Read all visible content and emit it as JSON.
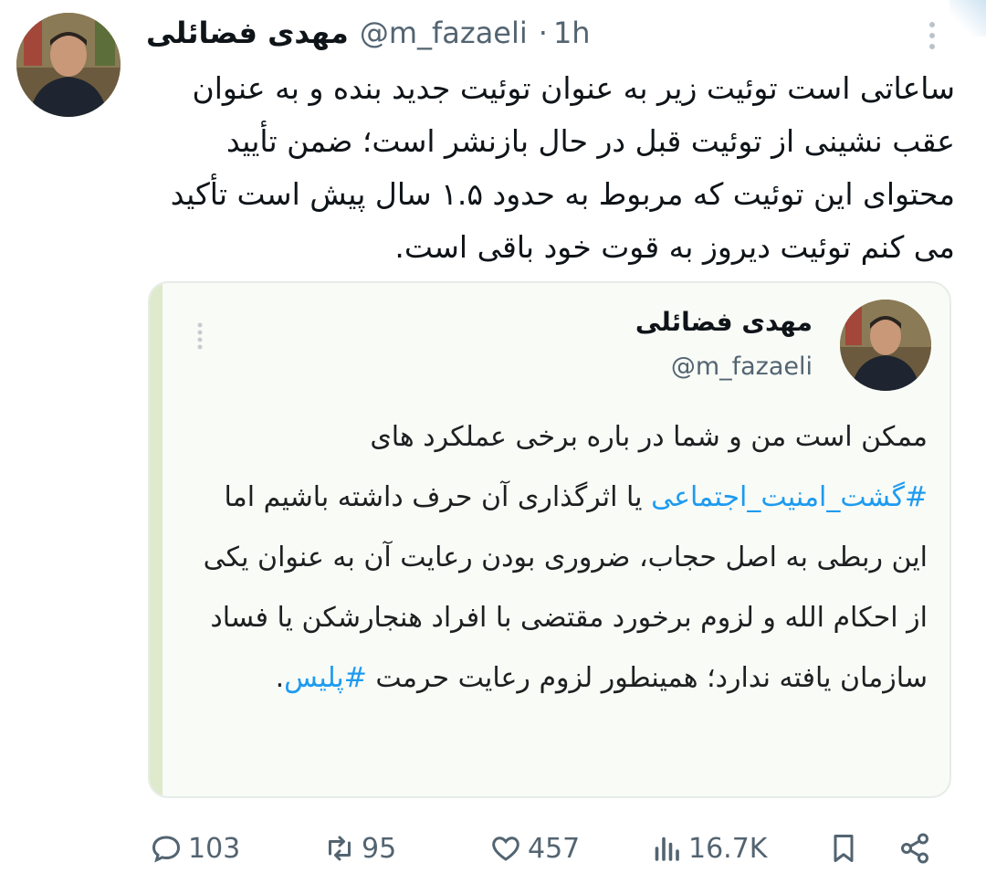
{
  "tweet": {
    "display_name": "مهدی فضائلی",
    "handle": "@m_fazaeli",
    "separator": "·",
    "time": "1h",
    "text": "ساعاتی است توئیت زیر به عنوان توئیت جدید بنده و به عنوان عقب نشینی از توئیت قبل در حال بازنشر است؛ ضمن تأیید محتوای این توئیت که مربوط به حدود ۱.۵ سال پیش است تأکید می کنم توئیت دیروز به قوت خود باقی است."
  },
  "quoted": {
    "display_name": "مهدی فضائلی",
    "handle": "@m_fazaeli",
    "text_part1": "ممکن است من و شما در باره برخی عملکرد های ",
    "hashtag1": "#گشت_امنیت_اجتماعی",
    "text_part2": " یا اثرگذاری آن حرف داشته باشیم اما این ربطی به اصل حجاب، ضروری بودن رعایت آن به عنوان یکی از احکام الله و لزوم برخورد مقتضی با افراد هنجارشکن یا فساد سازمان یافته ندارد؛ همینطور لزوم رعایت حرمت ",
    "hashtag2": "#پلیس",
    "text_part3": "."
  },
  "actions": {
    "replies": "103",
    "retweets": "95",
    "likes": "457",
    "views": "16.7K"
  },
  "icons": [
    "more-icon",
    "reply-icon",
    "retweet-icon",
    "like-icon",
    "views-icon",
    "bookmark-icon",
    "share-icon"
  ],
  "colors": {
    "accent": "#1d9bf0",
    "muted": "#536471",
    "quote_bar": "#dfe9cc"
  }
}
